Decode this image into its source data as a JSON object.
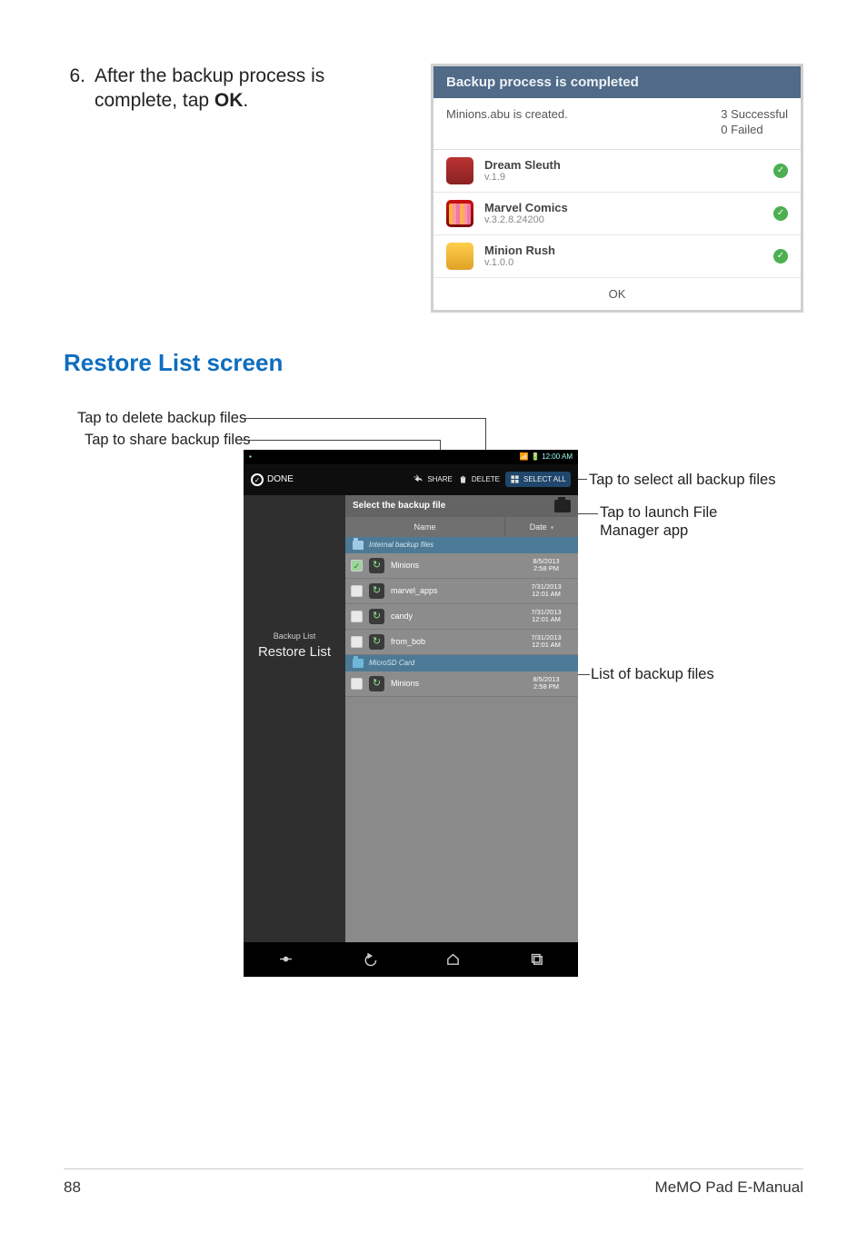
{
  "step": {
    "num": "6.",
    "text_a": "After the backup process is complete, tap ",
    "text_b": "OK",
    "text_c": "."
  },
  "shot1": {
    "title": "Backup process is completed",
    "created": "Minions.abu is created.",
    "success": "3 Successful",
    "failed": "0 Failed",
    "apps": [
      {
        "name": "Dream Sleuth",
        "ver": "v.1.9"
      },
      {
        "name": "Marvel Comics",
        "ver": "v.3.2.8.24200"
      },
      {
        "name": "Minion Rush",
        "ver": "v.1.0.0"
      }
    ],
    "ok": "OK"
  },
  "section_title": "Restore List screen",
  "callouts": {
    "delete": "Tap to delete backup files",
    "share": "Tap to share backup files",
    "selectall": "Tap to select all backup files",
    "fm1": "Tap to launch File",
    "fm2": "Manager app",
    "list": "List of backup files"
  },
  "phone": {
    "time": "12:00 AM",
    "toolbar": {
      "done": "DONE",
      "share": "SHARE",
      "delete": "DELETE",
      "selectall": "SELECT ALL"
    },
    "sidebar": {
      "backup": "Backup List",
      "restore": "Restore List"
    },
    "select_hdr": "Select the backup file",
    "cols": {
      "name": "Name",
      "date": "Date"
    },
    "groups": {
      "internal": "Internal backup files",
      "sd": "MicroSD Card"
    },
    "rows": [
      {
        "name": "Minions",
        "d1": "8/5/2013",
        "d2": "2:58 PM",
        "sel": true
      },
      {
        "name": "marvel_apps",
        "d1": "7/31/2013",
        "d2": "12:01 AM",
        "sel": false
      },
      {
        "name": "candy",
        "d1": "7/31/2013",
        "d2": "12:01 AM",
        "sel": false
      },
      {
        "name": "from_bob",
        "d1": "7/31/2013",
        "d2": "12:01 AM",
        "sel": false
      }
    ],
    "rows2": [
      {
        "name": "Minions",
        "d1": "8/5/2013",
        "d2": "2:58 PM",
        "sel": false
      }
    ]
  },
  "footer": {
    "page": "88",
    "book": "MeMO Pad E-Manual"
  }
}
